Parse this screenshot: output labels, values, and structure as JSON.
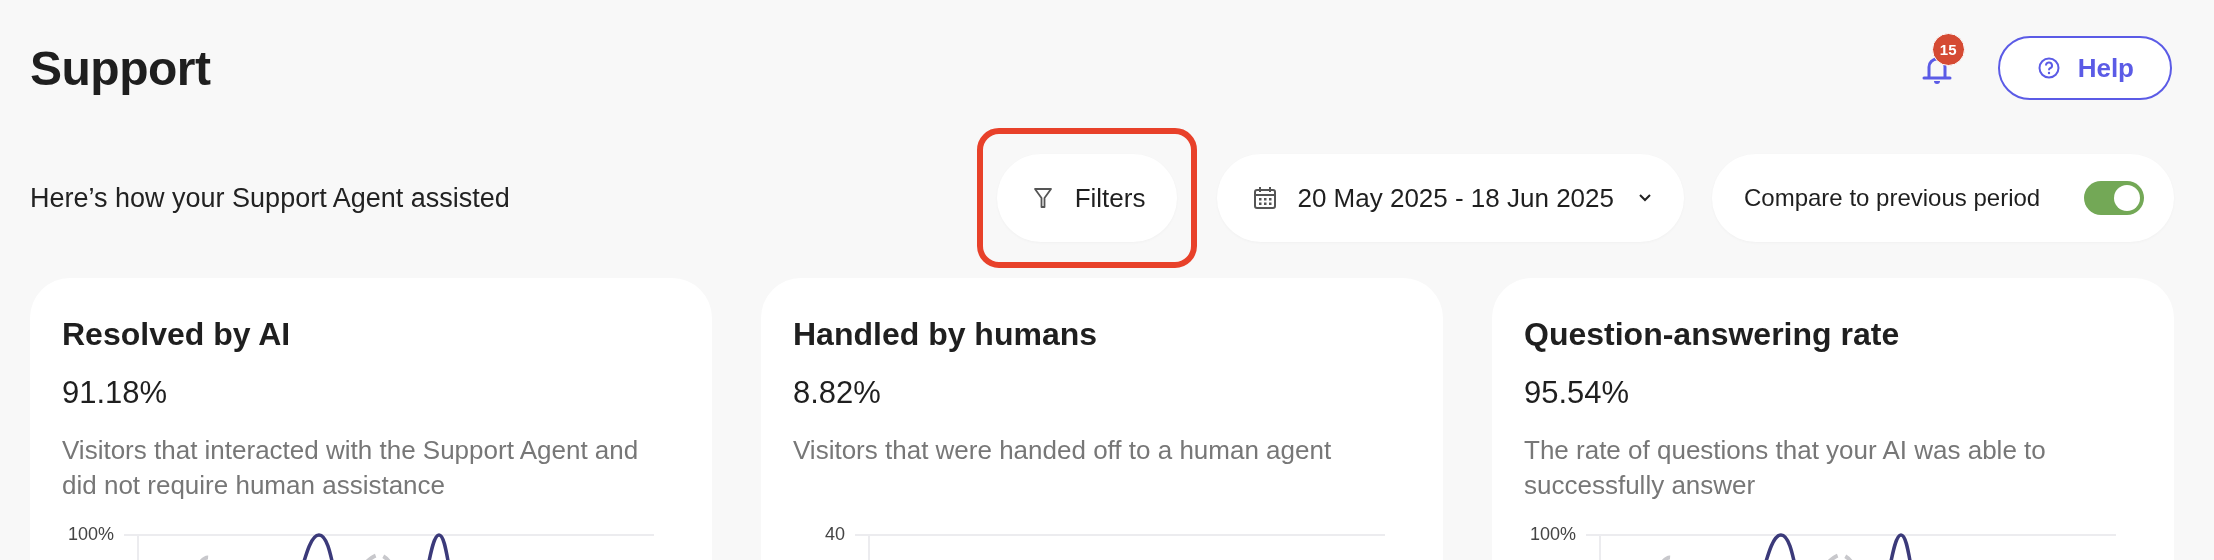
{
  "header": {
    "title": "Support",
    "notifications": {
      "count": "15"
    },
    "help_button": {
      "label": "Help"
    }
  },
  "subtitle": "Here’s how your Support Agent assisted",
  "filters_button": {
    "label": "Filters",
    "highlighted": true
  },
  "date_range": {
    "label": "20 May 2025 - 18 Jun 2025"
  },
  "compare": {
    "label": "Compare to previous period",
    "on": true
  },
  "cards": [
    {
      "title": "Resolved by AI",
      "value": "91.18%",
      "description": "Visitors that interacted with the Support Agent and did not require human assistance",
      "axis_label": "100%",
      "kind": "line"
    },
    {
      "title": "Handled by humans",
      "value": "8.82%",
      "description": "Visitors that were handed off to a human agent",
      "axis_label": "40",
      "kind": "empty"
    },
    {
      "title": "Question-answering rate",
      "value": "95.54%",
      "description": "The rate of questions that your AI was able to successfully answer",
      "axis_label": "100%",
      "kind": "line"
    }
  ]
}
